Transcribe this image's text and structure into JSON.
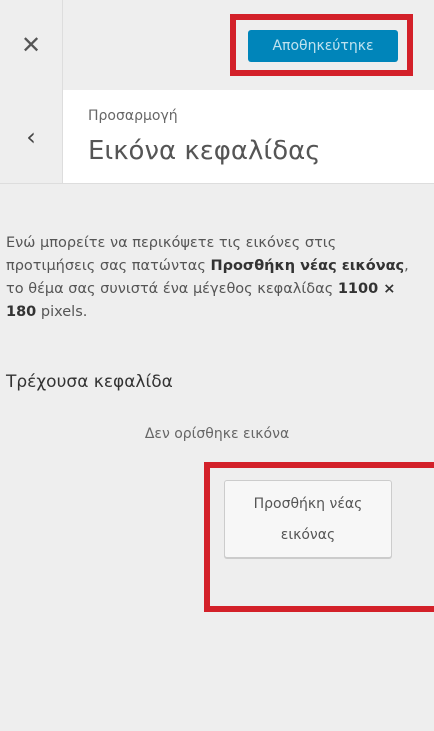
{
  "header": {
    "close_icon": "close-icon",
    "save_label": "Αποθηκεύτηκε",
    "highlight_color": "#d32029",
    "save_color": "#0085ba"
  },
  "section": {
    "back_icon": "chevron-left-icon",
    "breadcrumb": "Προσαρμογή",
    "title": "Εικόνα κεφαλίδας"
  },
  "content": {
    "description_part1": "Ενώ μπορείτε να περικόψετε τις εικόνες στις προτιμήσεις σας πατώντας ",
    "description_bold1": "Προσθήκη νέας εικόνας",
    "description_part2": ", το θέμα σας συνιστά ένα μέγεθος κεφαλίδας ",
    "description_bold2": "1100 × 180",
    "description_part3": " pixels.",
    "current_header_label": "Τρέχουσα κεφαλίδα",
    "no_image_text": "Δεν ορίσθηκε εικόνα",
    "add_button_label": "Προσθήκη νέας εικόνας"
  }
}
